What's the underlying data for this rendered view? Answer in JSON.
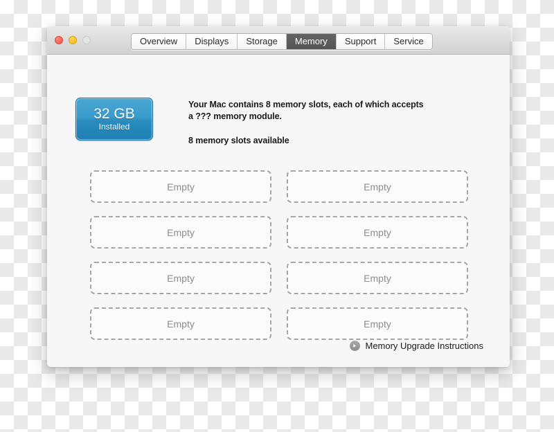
{
  "window": {
    "traffic_lights": [
      {
        "name": "close",
        "color": "#f85e52"
      },
      {
        "name": "minimize",
        "color": "#fbbd1f"
      },
      {
        "name": "zoom",
        "color": "#e4e4e4"
      }
    ]
  },
  "tabs": [
    {
      "label": "Overview",
      "selected": false
    },
    {
      "label": "Displays",
      "selected": false
    },
    {
      "label": "Storage",
      "selected": false
    },
    {
      "label": "Memory",
      "selected": true
    },
    {
      "label": "Support",
      "selected": false
    },
    {
      "label": "Service",
      "selected": false
    }
  ],
  "badge": {
    "amount": "32 GB",
    "state": "Installed",
    "accent": "#2a8bbd"
  },
  "description": {
    "line1": "Your Mac contains 8 memory slots, each of which accepts",
    "line2": "a ??? memory module.",
    "available": "8 memory slots available"
  },
  "slots": [
    {
      "label": "Empty"
    },
    {
      "label": "Empty"
    },
    {
      "label": "Empty"
    },
    {
      "label": "Empty"
    },
    {
      "label": "Empty"
    },
    {
      "label": "Empty"
    },
    {
      "label": "Empty"
    },
    {
      "label": "Empty"
    }
  ],
  "footer": {
    "icon": "arrow-right-circle-icon",
    "link_label": "Memory Upgrade Instructions"
  }
}
